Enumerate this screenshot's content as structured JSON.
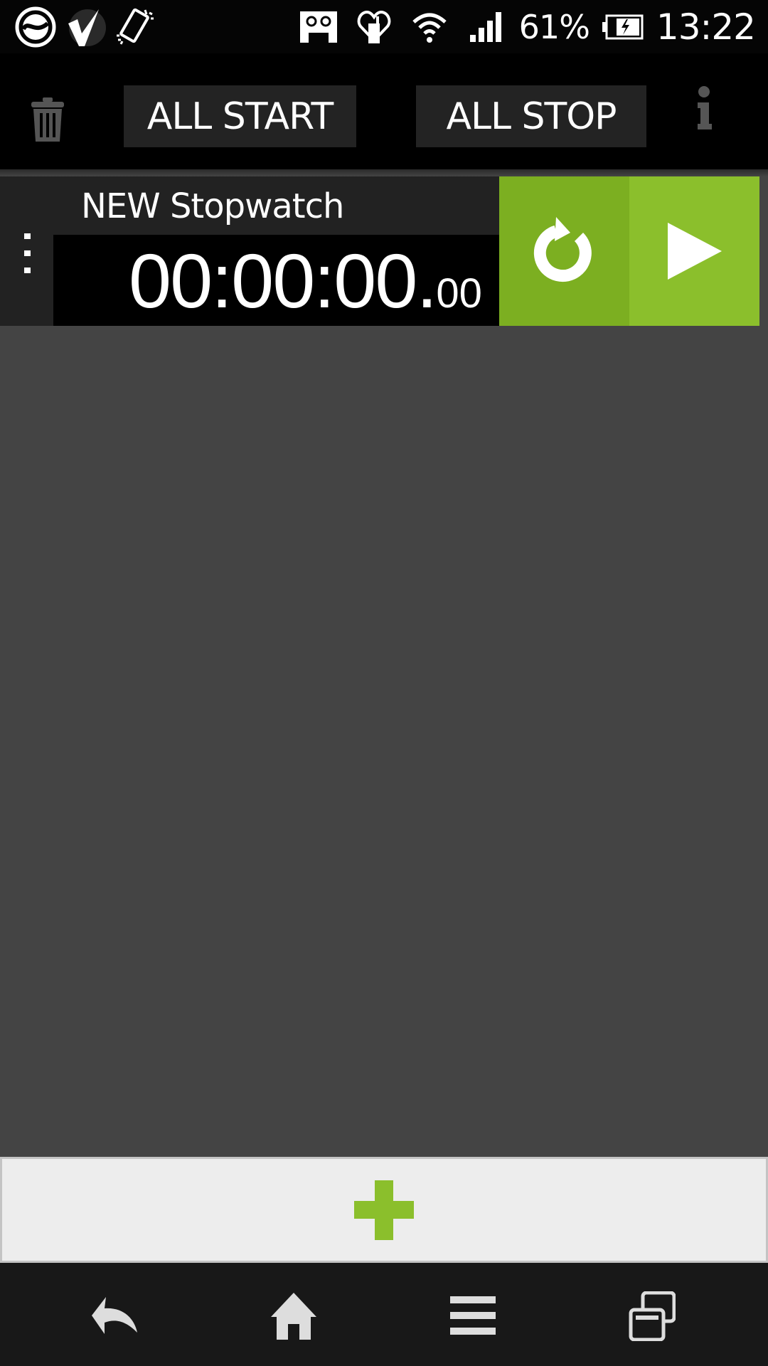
{
  "status_bar": {
    "left_icons": [
      "sync-app-icon",
      "checkmark-app-icon",
      "vibrate-icon"
    ],
    "right_icons": [
      "voicemail-icon",
      "heart-plug-icon",
      "wifi-icon",
      "signal-icon"
    ],
    "battery_percent": "61%",
    "battery_icon": "battery-charging-icon",
    "time": "13:22"
  },
  "toolbar": {
    "delete_icon": "trash-icon",
    "all_start_label": "ALL START",
    "all_stop_label": "ALL STOP",
    "info_icon": "info-icon"
  },
  "stopwatches": [
    {
      "name": "NEW Stopwatch",
      "time_main": "00:00:00.",
      "time_fraction": "00",
      "reset_icon": "reset-icon",
      "play_icon": "play-icon"
    }
  ],
  "add_bar": {
    "icon": "plus-icon"
  },
  "nav_bar": {
    "buttons": [
      "back-icon",
      "home-icon",
      "menu-icon",
      "recent-apps-icon"
    ]
  },
  "colors": {
    "accent_green": "#8bbf2c",
    "accent_green_dark": "#7caf21",
    "background": "#444444",
    "row_background": "#222222",
    "add_bar_background": "#ededed"
  }
}
